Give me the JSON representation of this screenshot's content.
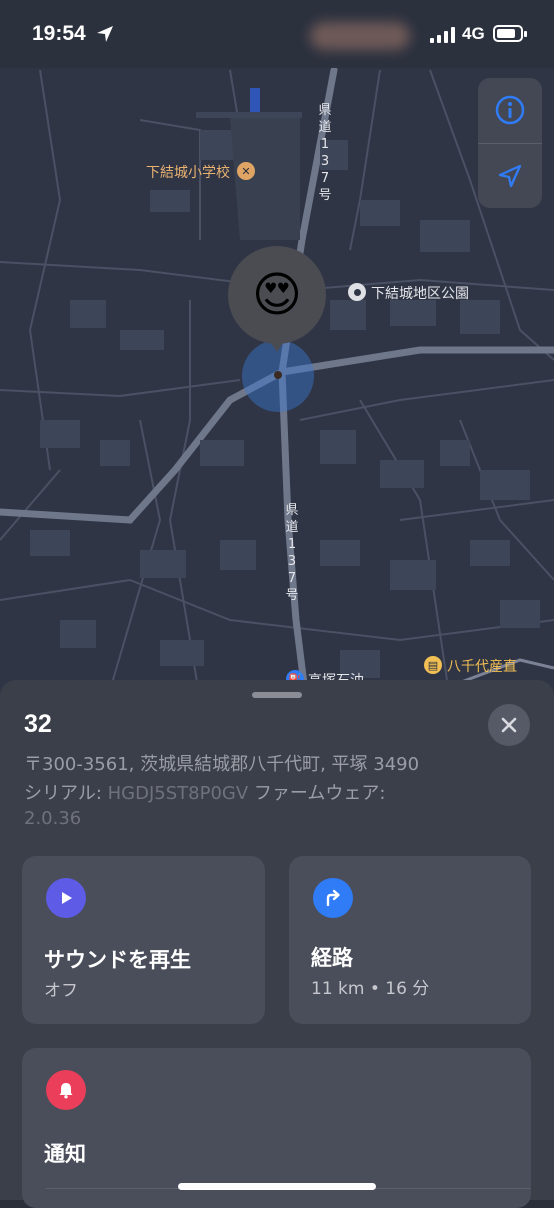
{
  "status": {
    "time": "19:54",
    "network": "4G"
  },
  "map": {
    "labels": {
      "school": "下結城小学校",
      "park": "下結城地区公園",
      "road_top": "県道137号",
      "road_mid": "県道137号",
      "gas_station": "高塚石油",
      "shop": "八千代産直"
    },
    "pin_emoji": "😍",
    "controls": [
      "info-icon",
      "location-arrow-icon"
    ]
  },
  "sheet": {
    "title": "32",
    "address": "〒300-3561, 茨城県結城郡八千代町, 平塚 3490",
    "serial_label": "シリアル: ",
    "serial_value": "HGDJ5ST8P0GV",
    "firmware_label": " ファームウェア:",
    "firmware_value": "2.0.36",
    "cards": {
      "sound": {
        "label": "サウンドを再生",
        "sub": "オフ",
        "icon": "play-icon",
        "color": "#5e5ce6"
      },
      "directions": {
        "label": "経路",
        "sub": "11 km • 16 分",
        "icon": "turn-right-arrow-icon",
        "color": "#2f7cf6"
      },
      "notify": {
        "label": "通知",
        "icon": "bell-icon",
        "color": "#ea3e5a"
      }
    }
  }
}
